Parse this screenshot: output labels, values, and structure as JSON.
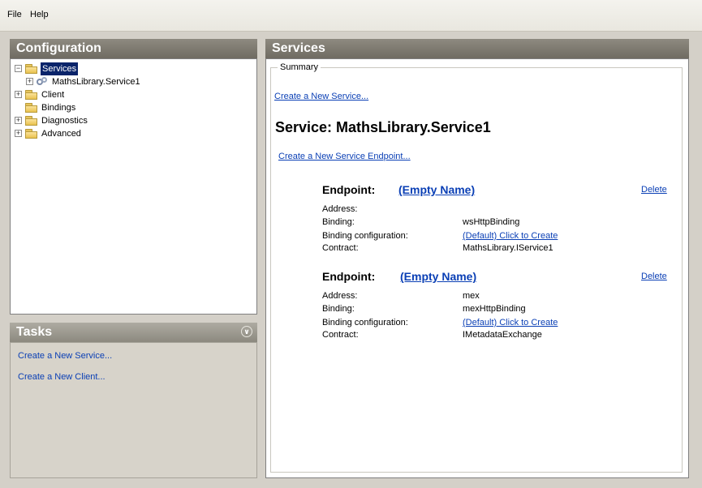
{
  "menu": {
    "file": "File",
    "help": "Help"
  },
  "configuration": {
    "title": "Configuration",
    "tree": [
      {
        "label": "Services",
        "expander": "−",
        "selected": true
      },
      {
        "label": "MathsLibrary.Service1",
        "expander": "+"
      },
      {
        "label": "Client",
        "expander": "+"
      },
      {
        "label": "Bindings"
      },
      {
        "label": "Diagnostics",
        "expander": "+"
      },
      {
        "label": "Advanced",
        "expander": "+"
      }
    ]
  },
  "tasks": {
    "title": "Tasks",
    "items": [
      "Create a New Service...",
      "Create a New Client..."
    ]
  },
  "services": {
    "title": "Services",
    "summary_label": "Summary",
    "create_service_link": "Create a New Service...",
    "service_title": "Service: MathsLibrary.Service1",
    "create_endpoint_link": "Create a New Service Endpoint...",
    "endpoint_label": "Endpoint:",
    "delete_label": "Delete",
    "field_labels": {
      "address": "Address:",
      "binding": "Binding:",
      "binding_config": "Binding configuration:",
      "contract": "Contract:"
    },
    "endpoints": [
      {
        "name": "(Empty Name)",
        "address": "",
        "binding": "wsHttpBinding",
        "binding_config": "(Default) Click to Create",
        "contract": "MathsLibrary.IService1"
      },
      {
        "name": "(Empty Name)",
        "address": "mex",
        "binding": "mexHttpBinding",
        "binding_config": "(Default) Click to Create",
        "contract": "IMetadataExchange"
      }
    ]
  }
}
